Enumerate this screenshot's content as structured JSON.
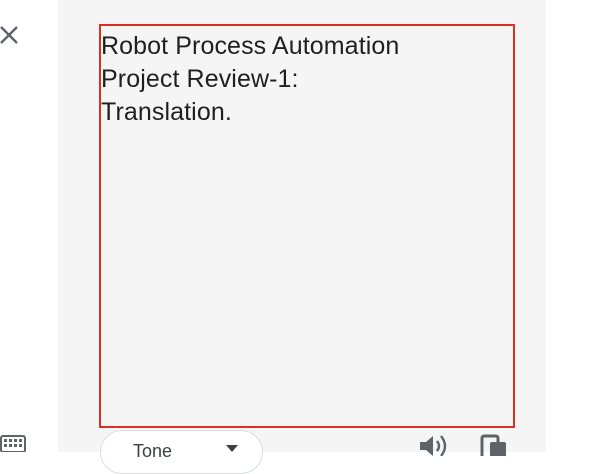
{
  "output": {
    "text": "Robot Process Automation\nProject Review-1:\nTranslation."
  },
  "controls": {
    "tone_label": "Tone"
  },
  "icons": {
    "close": "close-icon",
    "keyboard": "keyboard-icon",
    "caret": "caret-down-icon",
    "speaker": "speaker-icon",
    "copy": "copy-icon"
  },
  "colors": {
    "panel_background": "#f5f5f5",
    "highlight_border": "#d93025",
    "icon": "#5f6368"
  }
}
